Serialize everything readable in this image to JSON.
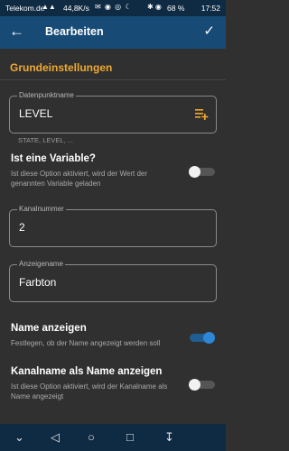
{
  "status_bar": {
    "carrier": "Telekom.de",
    "signal": "▲▲",
    "data_rate": "44,8K/s",
    "notifications": "✉ ◉ ◎ ☾",
    "system_icons": "✱ ◉",
    "battery": "68 %",
    "time": "17:52"
  },
  "app_bar": {
    "back_icon": "arrow-left-icon",
    "title": "Bearbeiten",
    "confirm_icon": "check-icon"
  },
  "section": {
    "title": "Grundeinstellungen"
  },
  "fields": {
    "datapoint": {
      "label": "Datenpunktname",
      "value": "LEVEL",
      "hint": "STATE, LEVEL, ..."
    },
    "channel": {
      "label": "Kanalnummer",
      "value": "2"
    },
    "display_name": {
      "label": "Anzeigename",
      "value": "Farbton"
    }
  },
  "settings": {
    "is_variable": {
      "title": "Ist eine Variable?",
      "description": "Ist diese Option aktiviert, wird der Wert der genannten Variable geladen",
      "enabled": false
    },
    "show_name": {
      "title": "Name anzeigen",
      "description": "Festlegen, ob der Name angezeigt werden soll",
      "enabled": true
    },
    "channel_as_name": {
      "title": "Kanalname als Name anzeigen",
      "description": "Ist diese Option aktiviert, wird der Kanalname als Name angezeigt",
      "enabled": false
    }
  },
  "colors": {
    "status_bar": "#0f2a43",
    "app_bar": "#174b75",
    "background": "#303030",
    "accent": "#f0a92f",
    "toggle_on": "#2e86d6"
  },
  "nav_bar": {
    "hide_icon": "chevron-down-icon",
    "back_icon": "triangle-left-icon",
    "home_icon": "circle-icon",
    "recents_icon": "square-icon",
    "notifications_icon": "pull-down-icon"
  }
}
